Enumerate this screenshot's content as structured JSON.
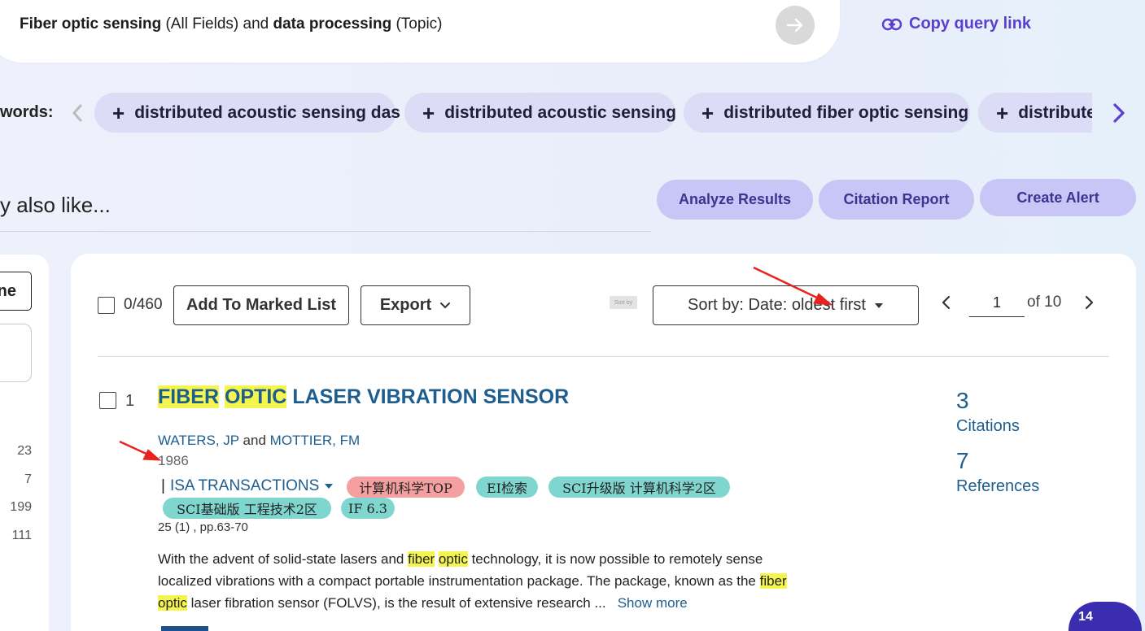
{
  "query": {
    "parts": [
      {
        "term": "Fiber optic sensing",
        "field": "(All Fields)"
      },
      {
        "joiner": "and"
      },
      {
        "term": "data processing",
        "field": "(Topic)"
      }
    ],
    "term1": "Fiber optic sensing",
    "field1": "(All Fields)",
    "joiner": "and",
    "term2": "data processing",
    "field2": "(Topic)",
    "copy_link_label": "Copy query link"
  },
  "keywords": {
    "label": "words:",
    "chips": [
      "distributed acoustic sensing das",
      "distributed acoustic sensing",
      "distributed fiber optic sensing",
      "distribute"
    ]
  },
  "also_like": "y also like...",
  "actions": {
    "analyze": "Analyze Results",
    "citation_report": "Citation Report",
    "create_alert": "Create Alert"
  },
  "left_panel": {
    "button_label": "ne",
    "counts": [
      "23",
      "7",
      "199",
      "111"
    ]
  },
  "toolbar": {
    "selected_count": "0/460",
    "add_to_marked": "Add To Marked List",
    "export": "Export",
    "sort_mini": "Sort by",
    "sort_label": "Sort by: Date: oldest first",
    "page_current": "1",
    "page_of": "of 10"
  },
  "result": {
    "index": "1",
    "title_hl1": "FIBER",
    "title_hl2": "OPTIC",
    "title_rest": "LASER VIBRATION SENSOR",
    "author1": "WATERS, JP",
    "author_join": "and",
    "author2": "MOTTIER, FM",
    "year": "1986",
    "journal": "ISA TRANSACTIONS",
    "tags": [
      "计算机科学TOP",
      "EI检索",
      "SCI升级版 计算机科学2区",
      "SCI基础版 工程技术2区",
      "IF 6.3"
    ],
    "volume": "25 (1) , pp.63-70",
    "abstract_1": "With the advent of solid-state lasers and ",
    "abstract_hl1": "fiber",
    "abstract_hl2": "optic",
    "abstract_2": " technology, it is now possible to remotely sense localized vibrations with a compact portable instrumentation package. The package, known as the ",
    "abstract_hl3": "fiber",
    "abstract_hl4": "optic",
    "abstract_3": " laser fibration sensor (FOLVS), is the result of extensive research ",
    "abstract_ellipsis": "...",
    "show_more": "Show more",
    "citations_count": "3",
    "citations_label": "Citations",
    "references_count": "7",
    "references_label": "References"
  },
  "help_badge": "14",
  "colors": {
    "accent_purple": "#5b3fd0",
    "chip_bg": "#dcdcf6",
    "action_bg": "#c8c6f7",
    "link_blue": "#1d5e8f",
    "highlight": "#f5f551",
    "annotation_red": "#e8231f"
  }
}
